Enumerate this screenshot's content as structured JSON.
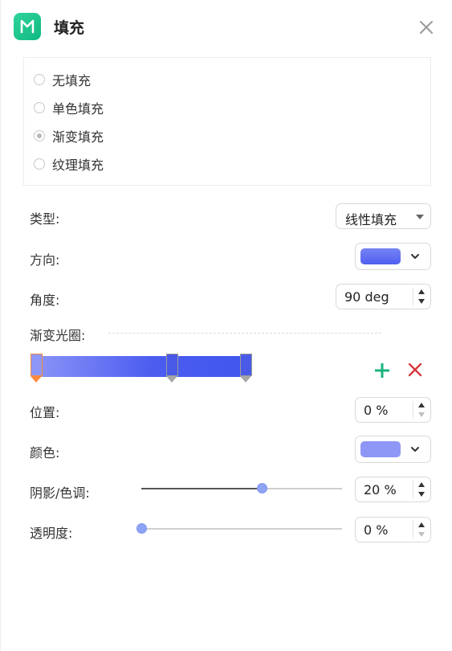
{
  "header": {
    "title": "填充",
    "logo_icon": "mindmaster-logo-icon",
    "close_icon": "close-icon"
  },
  "fill_options": [
    {
      "label": "无填充",
      "checked": false
    },
    {
      "label": "单色填充",
      "checked": false
    },
    {
      "label": "渐变填充",
      "checked": true
    },
    {
      "label": "纹理填充",
      "checked": false
    }
  ],
  "type": {
    "label": "类型:",
    "value": "线性填充"
  },
  "direction": {
    "label": "方向:",
    "swatch_color": "#5f6df0"
  },
  "angle": {
    "label": "角度:",
    "value": "90 deg"
  },
  "gradient": {
    "label": "渐变光圈:",
    "start_color": "#8a93f7",
    "end_color": "#4056ee",
    "add_icon": "plus-icon",
    "delete_icon": "delete-x-icon"
  },
  "position": {
    "label": "位置:",
    "value": "0 %"
  },
  "color": {
    "label": "颜色:",
    "swatch_color": "#8e97f6"
  },
  "shade": {
    "label": "阴影/色调:",
    "value": "20 %",
    "slider_level": 0.6
  },
  "transparency": {
    "label": "透明度:",
    "value": "0 %",
    "slider_level": 0.0
  },
  "colors": {
    "accent_green": "#19b37a",
    "delete_red": "#d8383f",
    "selected_stop": "#ff8a3d"
  }
}
